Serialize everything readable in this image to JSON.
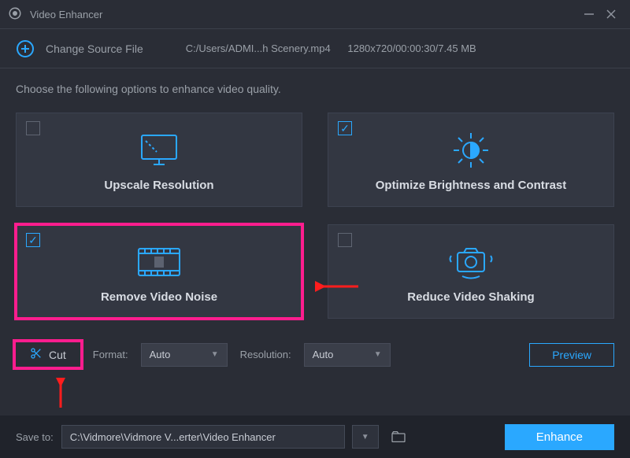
{
  "app": {
    "title": "Video Enhancer"
  },
  "topbar": {
    "change_source": "Change Source File",
    "path": "C:/Users/ADMI...h Scenery.mp4",
    "meta": "1280x720/00:00:30/7.45 MB"
  },
  "desc": "Choose the following options to enhance video quality.",
  "cards": {
    "upscale": {
      "label": "Upscale Resolution",
      "checked": false
    },
    "brightness": {
      "label": "Optimize Brightness and Contrast",
      "checked": true
    },
    "denoise": {
      "label": "Remove Video Noise",
      "checked": true
    },
    "shake": {
      "label": "Reduce Video Shaking",
      "checked": false
    }
  },
  "controls": {
    "cut": "Cut",
    "format_label": "Format:",
    "format_value": "Auto",
    "resolution_label": "Resolution:",
    "resolution_value": "Auto",
    "preview": "Preview"
  },
  "bottom": {
    "save_to_label": "Save to:",
    "path": "C:\\Vidmore\\Vidmore V...erter\\Video Enhancer",
    "enhance": "Enhance"
  }
}
